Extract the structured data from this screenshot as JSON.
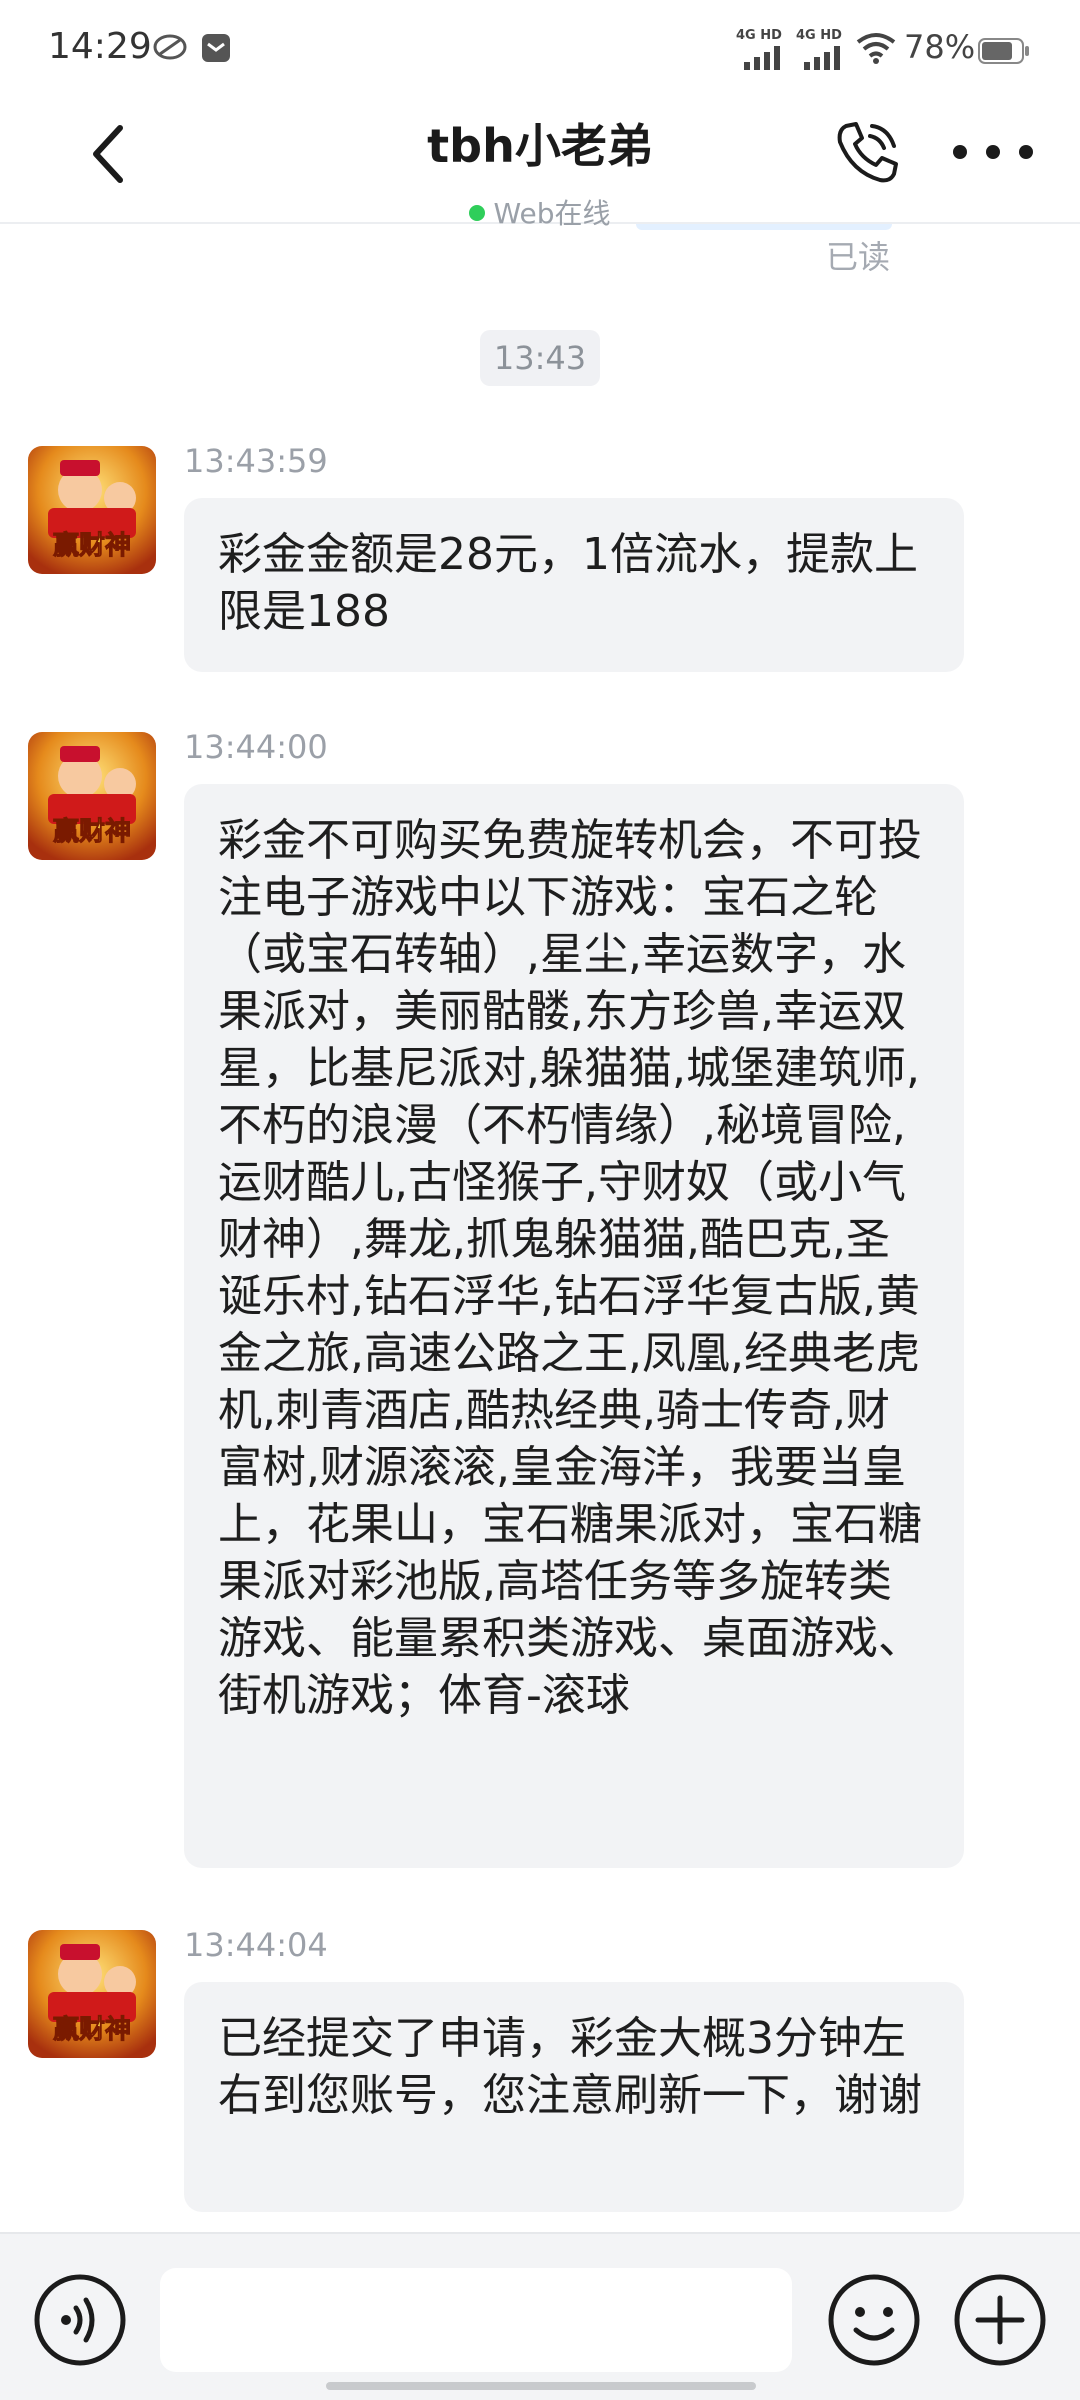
{
  "status_bar": {
    "time": "14:29",
    "signal1_label": "4G HD",
    "signal2_label": "4G HD",
    "battery_text": "78%"
  },
  "header": {
    "title": "tbh小老弟",
    "online_status": "Web在线"
  },
  "chat": {
    "read_receipt": "已读",
    "time_separator": "13:43",
    "messages": [
      {
        "time": "13:43:59",
        "text": "彩金金额是28元，1倍流水，提款上限是188"
      },
      {
        "time": "13:44:00",
        "text": "彩金不可购买免费旋转机会，不可投注电子游戏中以下游戏：宝石之轮（或宝石转轴）,星尘,幸运数字，水果派对，美丽骷髅,东方珍兽,幸运双星，比基尼派对,躲猫猫,城堡建筑师,不朽的浪漫（不朽情缘）,秘境冒险,运财酷儿,古怪猴子,守财奴（或小气财神）,舞龙,抓鬼躲猫猫,酷巴克,圣诞乐村,钻石浮华,钻石浮华复古版,黄金之旅,高速公路之王,凤凰,经典老虎机,刺青酒店,酷热经典,骑士传奇,财富树,财源滚滚,皇金海洋，我要当皇上，花果山，宝石糖果派对，宝石糖果派对彩池版,高塔任务等多旋转类游戏、能量累积类游戏、桌面游戏、街机游戏；体育-滚球"
      },
      {
        "time": "13:44:04",
        "text": "已经提交了申请，彩金大概3分钟左右到您账号，您注意刷新一下，谢谢"
      }
    ]
  },
  "avatar_logo_text": "赢财神",
  "colors": {
    "online_dot": "#2fce5a",
    "bubble_bg": "#f2f3f5",
    "input_bar_bg": "#f3f4f6"
  },
  "icons": {
    "back": "chevron-left-icon",
    "call": "phone-icon",
    "more": "more-dots-icon",
    "voice": "voice-icon",
    "emoji": "smiley-icon",
    "plus": "plus-icon"
  }
}
